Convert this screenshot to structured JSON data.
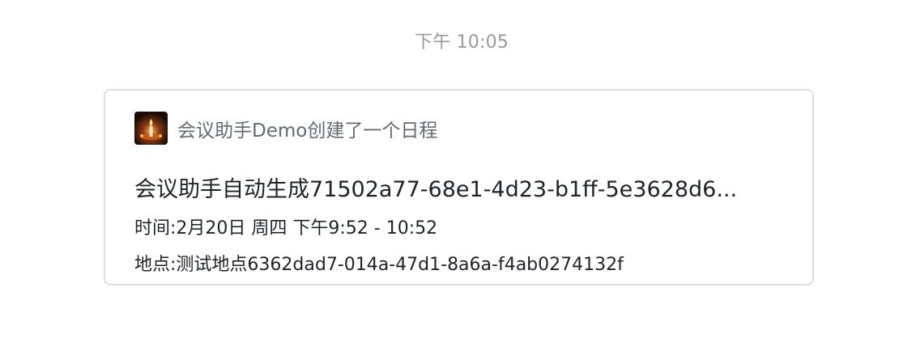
{
  "timestamp": "下午 10:05",
  "card": {
    "avatar_icon": "candle-avatar-icon",
    "header": "会议助手Demo创建了一个日程",
    "title": "会议助手自动生成71502a77-68e1-4d23-b1ff-5e3628d6...",
    "time_label": "时间:",
    "time_value": "2月20日 周四 下午9:52 - 10:52",
    "place_label": "地点:",
    "place_value": "测试地点6362dad7-014a-47d1-8a6a-f4ab0274132f"
  }
}
